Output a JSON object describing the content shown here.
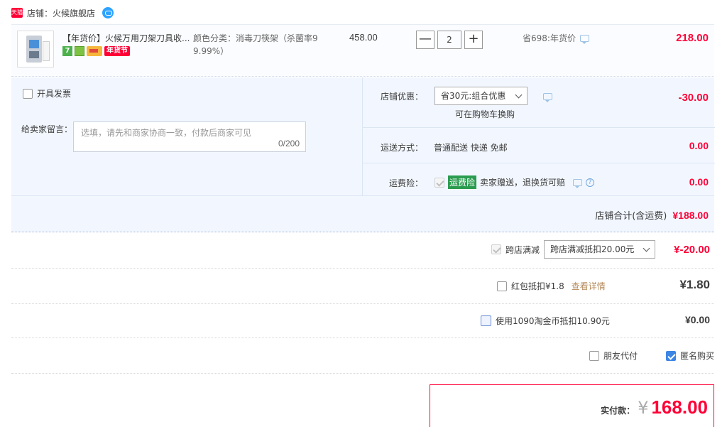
{
  "shop": {
    "label": "店铺：",
    "name": "火候旗舰店",
    "tmall_badge": "天猫"
  },
  "product": {
    "title": "【年货价】火候万用刀架刀具收...",
    "badges": [
      "7",
      "年货节"
    ],
    "sku_label": "颜色分类：",
    "sku_value": "消毒刀筷架（杀菌率99.99%）",
    "sku_line2": "9.99%）",
    "price": "458.00",
    "qty_minus": "—",
    "qty": "2",
    "qty_plus": "+",
    "saving": "省698:年货价",
    "subtotal": "218.00"
  },
  "invoice": {
    "label": "开具发票"
  },
  "note": {
    "label": "给卖家留言：",
    "placeholder": "选填，请先和商家协商一致，付款后商家可见",
    "counter": "0/200"
  },
  "shop_discount": {
    "label": "店铺优惠：",
    "selected": "省30元:组合优惠",
    "hint": "可在购物车换购",
    "amount": "-30.00"
  },
  "shipping": {
    "label": "运送方式：",
    "method": "普通配送 快递 免邮",
    "amount": "0.00"
  },
  "insurance": {
    "label": "运费险：",
    "tag": "运费险",
    "desc": "卖家赠送，退换货可赔",
    "help": "?",
    "amount": "0.00"
  },
  "shop_total": {
    "label": "店铺合计(含运费)",
    "amount": "¥188.00"
  },
  "cross_store": {
    "label": "跨店满减",
    "selected": "跨店满减抵扣20.00元",
    "amount": "¥-20.00"
  },
  "red_packet": {
    "label": "红包抵扣¥1.8",
    "link": "查看详情",
    "amount": "¥1.80"
  },
  "taojinbi": {
    "label": "使用1090淘金币抵扣10.90元",
    "amount": "¥0.00"
  },
  "friend_pay": {
    "label": "朋友代付"
  },
  "anonymous": {
    "label": "匿名购买"
  },
  "final": {
    "label": "实付款：",
    "currency": "¥",
    "amount": "168.00"
  },
  "colors": {
    "accent_red": "#ff0036",
    "blue_bg": "#f2f7ff",
    "check_blue": "#3d86e4"
  }
}
